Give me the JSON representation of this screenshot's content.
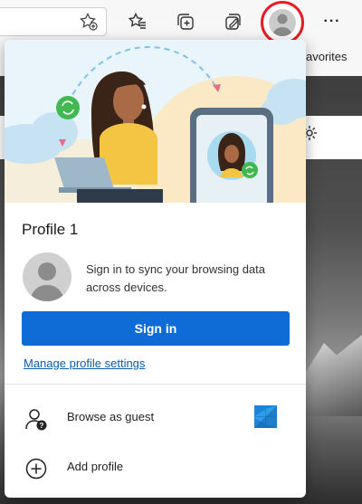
{
  "toolbar": {
    "icons": [
      "favorite-star-add-icon",
      "favorites-icon",
      "collections-icon",
      "web-capture-icon",
      "profile-icon",
      "more-icon"
    ],
    "more_label": "···"
  },
  "favorites_bar": {
    "label": "avorites"
  },
  "flyout": {
    "profile_name": "Profile 1",
    "signin_message": "Sign in to sync your browsing data across devices.",
    "signin_button": "Sign in",
    "manage_link": "Manage profile settings",
    "menu": [
      {
        "label": "Browse as guest",
        "icon": "guest-icon"
      },
      {
        "label": "Add profile",
        "icon": "add-circle-icon"
      }
    ]
  },
  "colors": {
    "accent": "#0f6cd6",
    "link": "#0b5cad",
    "highlight_ring": "#e51c23",
    "sync_badge": "#3fb950"
  }
}
